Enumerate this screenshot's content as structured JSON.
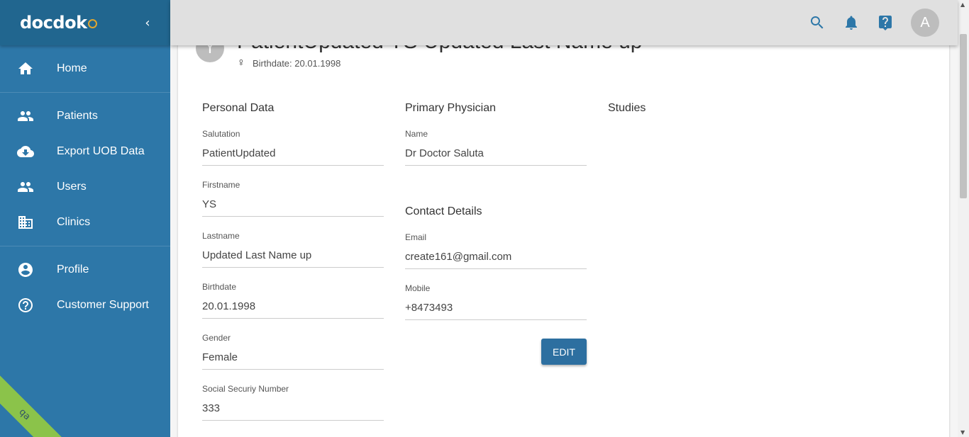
{
  "app": {
    "logo_text": "docdok"
  },
  "sidebar": {
    "collapse_label": "‹",
    "groups": [
      [
        {
          "label": "Home",
          "icon": "home-icon"
        }
      ],
      [
        {
          "label": "Patients",
          "icon": "people-icon"
        },
        {
          "label": "Export UOB Data",
          "icon": "cloud-download-icon"
        },
        {
          "label": "Users",
          "icon": "people-icon"
        },
        {
          "label": "Clinics",
          "icon": "building-icon"
        }
      ],
      [
        {
          "label": "Profile",
          "icon": "account-circle-icon"
        },
        {
          "label": "Customer Support",
          "icon": "help-circle-icon"
        }
      ]
    ],
    "ribbon": "qa"
  },
  "topbar": {
    "avatar_letter": "A"
  },
  "patient": {
    "avatar_letter": "Y",
    "name": "PatientUpdated YS Updated Last Name up",
    "birthdate_line": "Birthdate: 20.01.1998"
  },
  "personal_data": {
    "title": "Personal Data",
    "fields": [
      {
        "label": "Salutation",
        "value": "PatientUpdated"
      },
      {
        "label": "Firstname",
        "value": "YS"
      },
      {
        "label": "Lastname",
        "value": "Updated Last Name up"
      },
      {
        "label": "Birthdate",
        "value": "20.01.1998"
      },
      {
        "label": "Gender",
        "value": "Female"
      },
      {
        "label": "Social Securiy Number",
        "value": "333"
      }
    ]
  },
  "primary_physician": {
    "title": "Primary Physician",
    "fields": [
      {
        "label": "Name",
        "value": "Dr Doctor Saluta"
      }
    ]
  },
  "contact_details": {
    "title": "Contact Details",
    "fields": [
      {
        "label": "Email",
        "value": "create161@gmail.com"
      },
      {
        "label": "Mobile",
        "value": "+8473493"
      }
    ]
  },
  "studies": {
    "title": "Studies"
  },
  "edit_button": "EDIT",
  "colors": {
    "primary": "#2d77a8",
    "sidebar_header": "#21668f",
    "ribbon": "#8bc34a"
  }
}
